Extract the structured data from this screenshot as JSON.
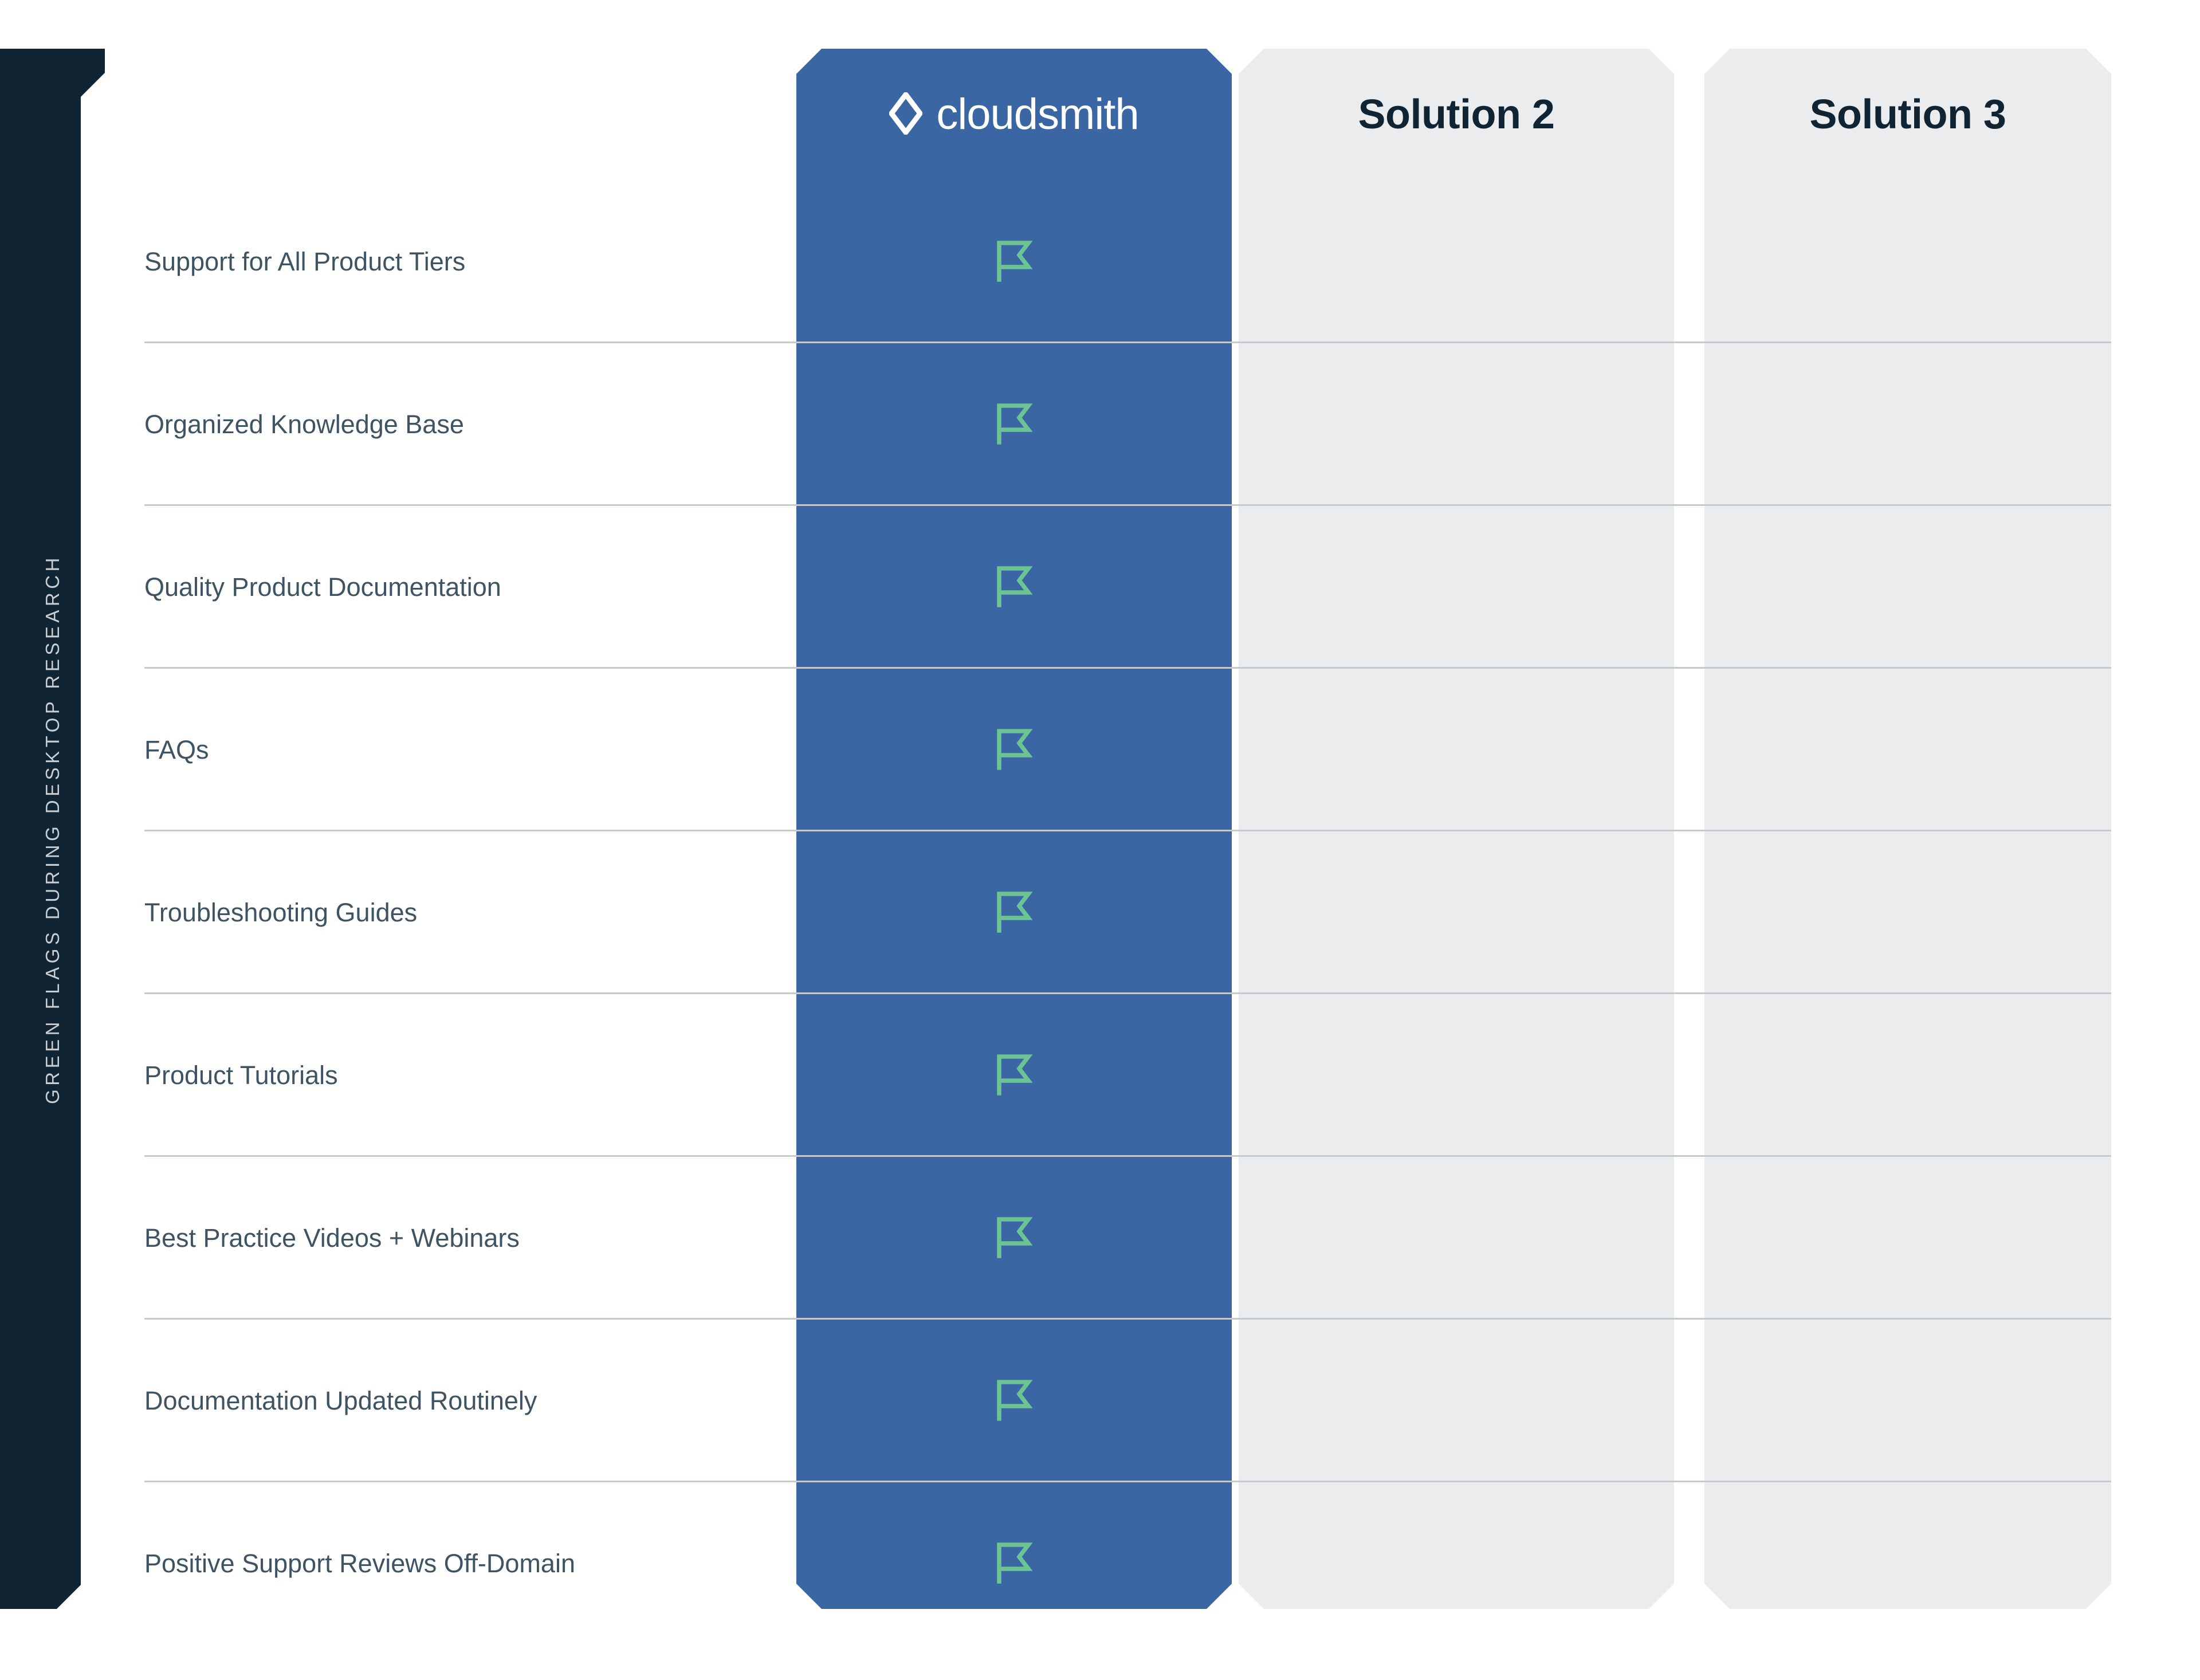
{
  "sidebar": {
    "label": "GREEN FLAGS DURING DESKTOP RESEARCH",
    "background_color": "#102434",
    "text_color": "#c9ced3"
  },
  "columns": [
    {
      "id": "cloudsmith",
      "title": "cloudsmith",
      "logo_icon": "diamond-outline-icon",
      "highlighted": true,
      "background_color": "#3a67a3",
      "title_color": "#ffffff"
    },
    {
      "id": "solution-2",
      "title": "Solution 2",
      "highlighted": false,
      "background_color": "#ebeced",
      "title_color": "#102434"
    },
    {
      "id": "solution-3",
      "title": "Solution 3",
      "highlighted": false,
      "background_color": "#ebeced",
      "title_color": "#102434"
    }
  ],
  "rows": [
    {
      "label": "Support for All Product Tiers",
      "cloudsmith": "flag-icon",
      "solution2": "",
      "solution3": ""
    },
    {
      "label": "Organized Knowledge Base",
      "cloudsmith": "flag-icon",
      "solution2": "",
      "solution3": ""
    },
    {
      "label": "Quality Product Documentation",
      "cloudsmith": "flag-icon",
      "solution2": "",
      "solution3": ""
    },
    {
      "label": "FAQs",
      "cloudsmith": "flag-icon",
      "solution2": "",
      "solution3": ""
    },
    {
      "label": "Troubleshooting Guides",
      "cloudsmith": "flag-icon",
      "solution2": "",
      "solution3": ""
    },
    {
      "label": "Product Tutorials",
      "cloudsmith": "flag-icon",
      "solution2": "",
      "solution3": ""
    },
    {
      "label": "Best Practice Videos + Webinars",
      "cloudsmith": "flag-icon",
      "solution2": "",
      "solution3": ""
    },
    {
      "label": "Documentation Updated Routinely",
      "cloudsmith": "flag-icon",
      "solution2": "",
      "solution3": ""
    },
    {
      "label": "Positive Support Reviews Off-Domain",
      "cloudsmith": "flag-icon",
      "solution2": "",
      "solution3": ""
    }
  ],
  "theme": {
    "flag_color": "#6cc492",
    "divider_color": "#c5cacc",
    "label_color": "#3e5463",
    "page_background": "#ffffff"
  }
}
